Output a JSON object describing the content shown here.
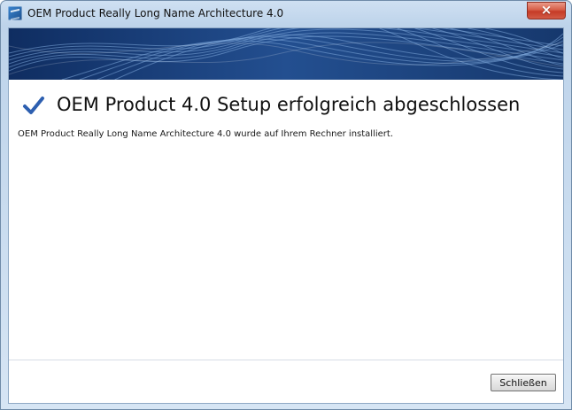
{
  "window": {
    "title": "OEM Product Really Long Name Architecture 4.0"
  },
  "header": {
    "headline": "OEM Product 4.0 Setup erfolgreich abgeschlossen",
    "message": "OEM Product Really Long Name Architecture 4.0 wurde auf Ihrem Rechner installiert."
  },
  "footer": {
    "close_button_label": "Schließen"
  },
  "icons": {
    "app": "app-icon",
    "close": "close-icon",
    "success": "checkmark-icon"
  },
  "colors": {
    "accent_blue": "#2d5fb0",
    "banner_blue": "#1f4b8b",
    "close_red": "#c53b27"
  },
  "glyphs": {
    "close": "×"
  }
}
